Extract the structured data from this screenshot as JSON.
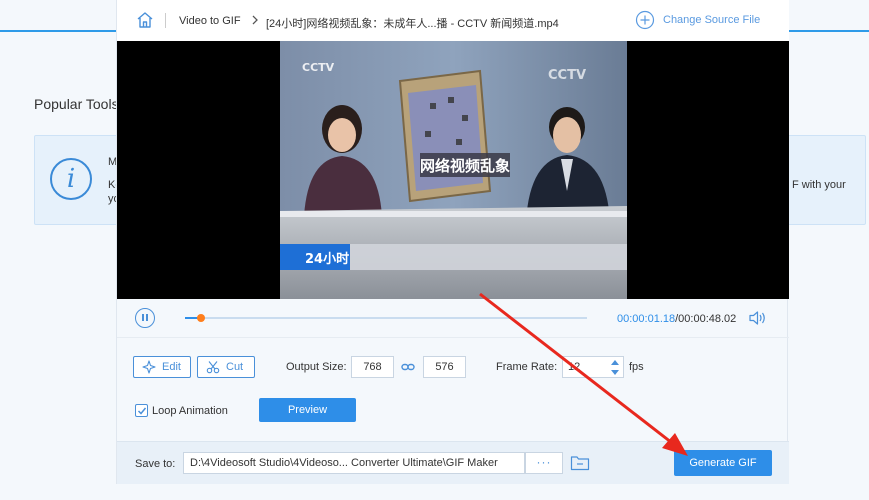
{
  "background": {
    "section_title": "Popular Tools",
    "card_line1": "M",
    "card_line2": "Ke",
    "card_line3": "yo",
    "card_right": "F with your"
  },
  "header": {
    "breadcrumb_root": "Video to GIF",
    "file_name": "[24小时]网络视频乱象：未成年人...播 - CCTV 新闻频道.mp4",
    "change_source": "Change Source File"
  },
  "video": {
    "channel_logo": "CCTV",
    "screen_title": "网络视频乱象",
    "program_tag": "24小时"
  },
  "player": {
    "progress": 0.04,
    "current_time": "00:00:01.18",
    "total_time": "/00:00:48.02"
  },
  "controls": {
    "edit_label": "Edit",
    "cut_label": "Cut",
    "output_size_label": "Output Size:",
    "width": "768",
    "height": "576",
    "frame_rate_label": "Frame Rate:",
    "frame_rate": "12",
    "fps_label": "fps",
    "loop_label": "Loop Animation",
    "loop_checked": true,
    "preview_label": "Preview"
  },
  "save": {
    "label": "Save to:",
    "path": "D:\\4Videosoft Studio\\4Videoso... Converter Ultimate\\GIF Maker",
    "browse_label": "···",
    "generate_label": "Generate GIF"
  },
  "colors": {
    "accent": "#2e8ee8",
    "knob": "#ff7e1c",
    "annotation_arrow": "#e8281e"
  }
}
